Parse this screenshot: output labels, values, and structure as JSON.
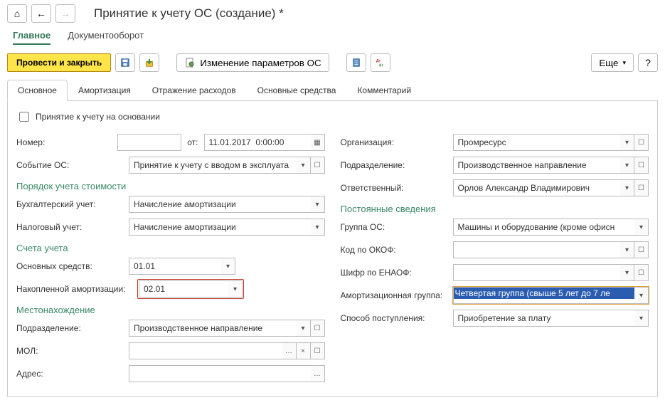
{
  "title": "Принятие к учету ОС (создание) *",
  "nav": {
    "main": "Главное",
    "docflow": "Документооборот"
  },
  "toolbar": {
    "post_close": "Провести и закрыть",
    "change_params": "Изменение параметров ОС",
    "more": "Еще",
    "help": "?"
  },
  "tabs": {
    "main": "Основное",
    "amort": "Амортизация",
    "expenses": "Отражение расходов",
    "assets": "Основные средства",
    "comment": "Комментарий"
  },
  "form": {
    "on_basis_label": "Принятие к учету на основании",
    "number_label": "Номер:",
    "number_value": "",
    "from_label": "от:",
    "date_value": "11.01.2017  0:00:00",
    "event_label": "Событие ОС:",
    "event_value": "Принятие к учету с вводом в эксплуата",
    "cost_section": "Порядок учета стоимости",
    "acc_label": "Бухгалтерский учет:",
    "acc_value": "Начисление амортизации",
    "tax_label": "Налоговый учет:",
    "tax_value": "Начисление амортизации",
    "accounts_section": "Счета учета",
    "asset_acc_label": "Основных средств:",
    "asset_acc_value": "01.01",
    "depr_acc_label": "Накопленной амортизации:",
    "depr_acc_value": "02.01",
    "location_section": "Местонахождение",
    "dept_label": "Подразделение:",
    "dept_value": "Производственное направление",
    "mol_label": "МОЛ:",
    "mol_value": "",
    "address_label": "Адрес:",
    "address_value": "",
    "org_label": "Организация:",
    "org_value": "Промресурс",
    "dept2_label": "Подразделение:",
    "dept2_value": "Производственное направление",
    "resp_label": "Ответственный:",
    "resp_value": "Орлов Александр Владимирович",
    "const_section": "Постоянные сведения",
    "group_label": "Группа ОС:",
    "group_value": "Машины и оборудование (кроме офисн",
    "okof_label": "Код по ОКОФ:",
    "okof_value": "",
    "enaof_label": "Шифр по ЕНАОФ:",
    "enaof_value": "",
    "amgroup_label": "Амортизационная группа:",
    "amgroup_value": "Четвертая группа (свыше 5 лет до 7 ле",
    "method_label": "Способ поступления:",
    "method_value": "Приобретение за плату"
  },
  "glyphs": {
    "home": "⌂",
    "back": "←",
    "forward": "→",
    "dropdown": "▾",
    "open": "☐",
    "calendar": "▦",
    "ellipsis": "…",
    "clear": "×"
  }
}
